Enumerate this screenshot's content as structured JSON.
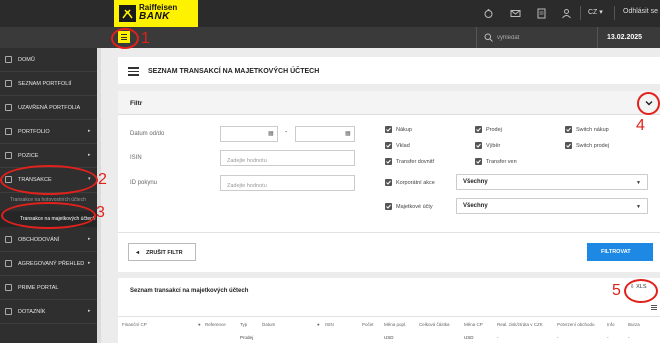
{
  "header": {
    "brand_line1": "Raiffeisen",
    "brand_line2": "BANK",
    "language": "CZ",
    "logout": "Odhlásit se",
    "search_placeholder": "vyhledat",
    "date": "13.02.2025",
    "icons": [
      "piggy-bank-icon",
      "mail-icon",
      "document-icon",
      "user-icon"
    ]
  },
  "sidebar": {
    "items": [
      {
        "label": "Domů",
        "icon": "home-icon"
      },
      {
        "label": "Seznam portfolií",
        "icon": "list-icon"
      },
      {
        "label": "Uzavřená portfolia",
        "icon": "archive-icon"
      },
      {
        "label": "Portfolio",
        "icon": "folder-icon",
        "caret": "▸"
      },
      {
        "label": "Pozice",
        "icon": "position-icon",
        "caret": "▸"
      },
      {
        "label": "Transakce",
        "icon": "transaction-icon",
        "caret": "▾"
      },
      {
        "label": "Obchodování",
        "icon": "trade-icon",
        "caret": "▸"
      },
      {
        "label": "Agregovaný přehled",
        "icon": "aggregate-icon",
        "caret": "▸"
      },
      {
        "label": "Prime portal",
        "icon": "portal-icon"
      },
      {
        "label": "Dotazník",
        "icon": "survey-icon",
        "caret": "▸"
      }
    ],
    "sub_faded": "Transakce na hotovostních účtech",
    "sub_active": "Transakce na majetkových účtech"
  },
  "annotations": [
    "1",
    "2",
    "3",
    "4",
    "5"
  ],
  "page": {
    "title": "SEZNAM TRANSAKCÍ NA MAJETKOVÝCH ÚČTECH"
  },
  "filter": {
    "title": "Filtr",
    "date_label": "Datum od/do",
    "date_separator": "-",
    "isin_label": "ISIN",
    "isin_placeholder": "Zadejte hodnotu",
    "order_label": "ID pokynu",
    "order_placeholder": "Zadejte hodnotu",
    "checkboxes": [
      {
        "label": "Nákup",
        "checked": true
      },
      {
        "label": "Prodej",
        "checked": true
      },
      {
        "label": "Switch nákup",
        "checked": true
      },
      {
        "label": "Vklad",
        "checked": true
      },
      {
        "label": "Výběr",
        "checked": true
      },
      {
        "label": "Switch prodej",
        "checked": true
      },
      {
        "label": "Transfer dovnitř",
        "checked": true
      },
      {
        "label": "Transfer ven",
        "checked": true
      }
    ],
    "corporate_label": "Korporátní akce",
    "corporate_value": "Všechny",
    "property_label": "Majetkové účty",
    "property_value": "Všechny",
    "clear_button": "ZRUŠIT FILTR",
    "filter_button": "FILTROVAT"
  },
  "list": {
    "title": "Seznam transakcí na majetkových účtech",
    "export_label": "XLS",
    "columns": [
      "Finanční CP",
      "Reference",
      "Typ",
      "Datum",
      "ISIN",
      "Počet",
      "Měna popl.",
      "Celková částka",
      "Měna CP",
      "Real. zisk/ztráta v CZK",
      "Potvrzení obchodu",
      "Info",
      "Burza"
    ],
    "rows": [
      {
        "Typ": "Prodej",
        "Měna popl.": "USD",
        "Měna CP": "USD",
        "Real. zisk/ztráta v CZK": "-",
        "Potvrzení obchodu": "-",
        "Info": "-",
        "Burza": "-"
      }
    ]
  },
  "colors": {
    "brand_yellow": "#fff200",
    "sidebar_bg": "#2f2f2f",
    "accent_blue": "#1e88e5",
    "annotation_red": "#e0211c"
  }
}
